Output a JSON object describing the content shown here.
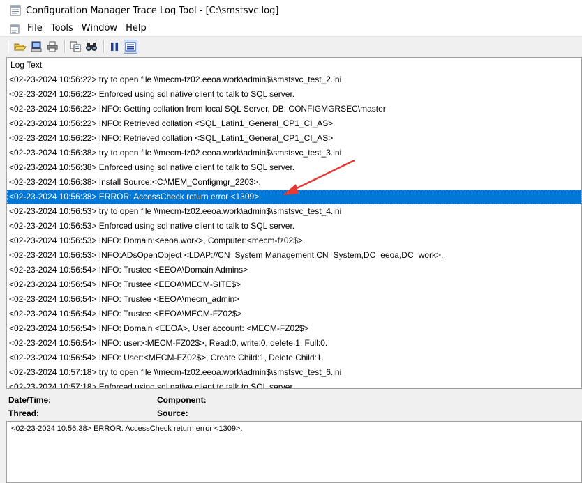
{
  "window": {
    "title": "Configuration Manager Trace Log Tool - [C:\\smstsvc.log]",
    "accent": "#0078d7"
  },
  "menu": {
    "items": [
      "File",
      "Tools",
      "Window",
      "Help"
    ]
  },
  "toolbar": {
    "icons": [
      "open-icon",
      "print-preview-icon",
      "print-icon",
      "copy-icon",
      "find-icon",
      "pause-icon",
      "view-toggle-icon"
    ]
  },
  "log": {
    "column_header": "Log Text",
    "selected_index": 8,
    "rows": [
      "<02-23-2024 10:56:22> try to open file \\\\mecm-fz02.eeoa.work\\admin$\\smstsvc_test_2.ini",
      "<02-23-2024 10:56:22> Enforced using sql native client to talk to SQL server.",
      "<02-23-2024 10:56:22> INFO: Getting collation from local SQL Server, DB: CONFIGMGRSEC\\master",
      "<02-23-2024 10:56:22> INFO: Retrieved collation <SQL_Latin1_General_CP1_CI_AS>",
      "<02-23-2024 10:56:22> INFO: Retrieved collation <SQL_Latin1_General_CP1_CI_AS>",
      "<02-23-2024 10:56:38> try to open file \\\\mecm-fz02.eeoa.work\\admin$\\smstsvc_test_3.ini",
      "<02-23-2024 10:56:38> Enforced using sql native client to talk to SQL server.",
      "<02-23-2024 10:56:38> Install Source:<C:\\MEM_Configmgr_2203>.",
      "<02-23-2024 10:56:38> ERROR: AccessCheck return error <1309>.",
      "<02-23-2024 10:56:53> try to open file \\\\mecm-fz02.eeoa.work\\admin$\\smstsvc_test_4.ini",
      "<02-23-2024 10:56:53> Enforced using sql native client to talk to SQL server.",
      "<02-23-2024 10:56:53> INFO: Domain:<eeoa.work>, Computer:<mecm-fz02$>.",
      "<02-23-2024 10:56:53> INFO:ADsOpenObject <LDAP://CN=System Management,CN=System,DC=eeoa,DC=work>.",
      "<02-23-2024 10:56:54> INFO: Trustee <EEOA\\Domain Admins>",
      "<02-23-2024 10:56:54> INFO: Trustee <EEOA\\MECM-SITE$>",
      "<02-23-2024 10:56:54> INFO: Trustee <EEOA\\mecm_admin>",
      "<02-23-2024 10:56:54> INFO: Trustee <EEOA\\MECM-FZ02$>",
      "<02-23-2024 10:56:54> INFO: Domain <EEOA>, User account: <MECM-FZ02$>",
      "<02-23-2024 10:56:54> INFO: user:<MECM-FZ02$>, Read:0, write:0, delete:1, Full:0.",
      "<02-23-2024 10:56:54> INFO: User:<MECM-FZ02$>, Create Child:1, Delete Child:1.",
      "<02-23-2024 10:57:18> try to open file \\\\mecm-fz02.eeoa.work\\admin$\\smstsvc_test_6.ini",
      "<02-23-2024 10:57:18> Enforced using sql native client to talk to SQL server."
    ]
  },
  "details": {
    "datetime_label": "Date/Time:",
    "component_label": "Component:",
    "thread_label": "Thread:",
    "source_label": "Source:",
    "message": "<02-23-2024 10:56:38> ERROR: AccessCheck return error <1309>."
  },
  "annotation": {
    "arrow_color": "#e53935"
  }
}
